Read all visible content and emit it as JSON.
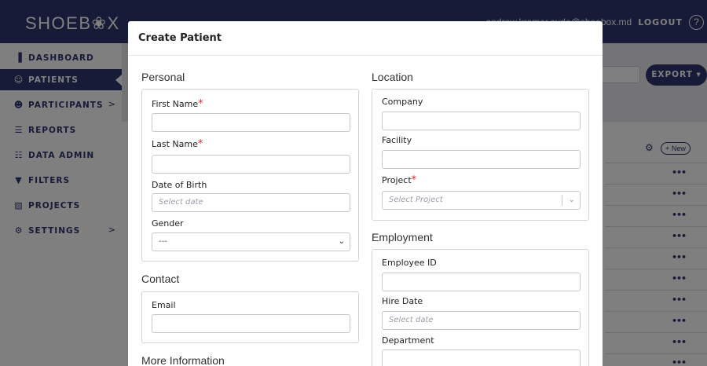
{
  "app": {
    "logo": "SHOEB❀X",
    "user_email": "andrew.kramer.sudo@shoebox.md",
    "logout_label": "LOGOUT",
    "help_glyph": "?"
  },
  "sidebar": {
    "items": [
      {
        "label": "DASHBOARD",
        "icon": "bar-chart-icon",
        "glyph": "▐",
        "active": false,
        "arrow": ""
      },
      {
        "label": "PATIENTS",
        "icon": "patients-icon",
        "glyph": "☺",
        "active": true,
        "arrow": ""
      },
      {
        "label": "PARTICIPANTS",
        "icon": "participants-icon",
        "glyph": "☻",
        "active": false,
        "arrow": ">"
      },
      {
        "label": "REPORTS",
        "icon": "report-icon",
        "glyph": "☰",
        "active": false,
        "arrow": ""
      },
      {
        "label": "DATA ADMIN",
        "icon": "data-admin-icon",
        "glyph": "☷",
        "active": false,
        "arrow": ""
      },
      {
        "label": "FILTERS",
        "icon": "filter-icon",
        "glyph": "▼",
        "active": false,
        "arrow": ""
      },
      {
        "label": "PROJECTS",
        "icon": "projects-icon",
        "glyph": "▧",
        "active": false,
        "arrow": ""
      },
      {
        "label": "SETTINGS",
        "icon": "gear-icon",
        "glyph": "⚙",
        "active": false,
        "arrow": ">"
      }
    ]
  },
  "background": {
    "export_label": "EXPORT ▾",
    "new_label": "+ New",
    "row_action": "•••"
  },
  "modal": {
    "title": "Create Patient",
    "personal": {
      "section_title": "Personal",
      "first_name_label": "First Name",
      "last_name_label": "Last Name",
      "dob_label": "Date of Birth",
      "dob_placeholder": "Select date",
      "gender_label": "Gender",
      "gender_value": "---",
      "required_mark": "*"
    },
    "contact": {
      "section_title": "Contact",
      "email_label": "Email"
    },
    "more_info": {
      "section_title": "More Information"
    },
    "location": {
      "section_title": "Location",
      "company_label": "Company",
      "facility_label": "Facility",
      "project_label": "Project",
      "project_placeholder": "Select Project",
      "required_mark": "*"
    },
    "employment": {
      "section_title": "Employment",
      "employee_id_label": "Employee ID",
      "hire_date_label": "Hire Date",
      "hire_date_placeholder": "Select date",
      "department_label": "Department"
    }
  }
}
